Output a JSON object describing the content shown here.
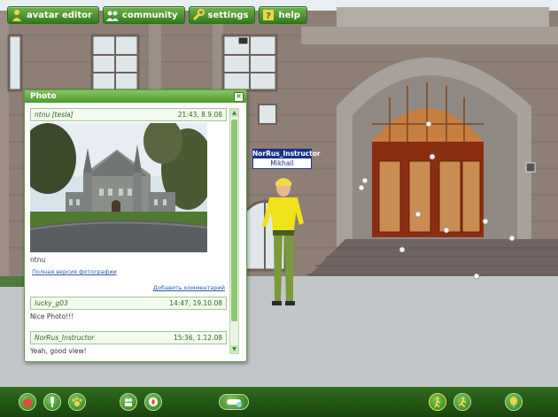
{
  "menu": {
    "avatar_editor": "avatar editor",
    "community": "community",
    "settings": "settings",
    "help": "help"
  },
  "nametag": {
    "name": "NorRus_Instructor",
    "subtitle": "Mikhail"
  },
  "photo_window": {
    "title": "Photo",
    "close_symbol": "×",
    "photo_post": {
      "author": "ntnu [tesla]",
      "timestamp": "21:43, 8.9.08",
      "caption": "ntnu",
      "full_version_link": "Полная версия фотографии",
      "add_comment_link": "Добавить комментарий"
    },
    "comments": [
      {
        "author": "lucky_g03",
        "timestamp": "14:47, 19.10.08",
        "text": "Nice Photo!!!"
      },
      {
        "author": "NorRus_Instructor",
        "timestamp": "15:36, 1.12.08",
        "text": "Yeah, good view!"
      }
    ]
  },
  "icons": {
    "top": [
      "avatar-icon",
      "community-icon",
      "wrench-icon",
      "help-icon"
    ],
    "bottom": [
      "apple-icon",
      "microphone-icon",
      "paw-icon",
      "people-icon",
      "compass-icon",
      "hand-icon",
      "walk-icon",
      "run-icon",
      "balloon-icon"
    ]
  },
  "colors": {
    "ui_green": "#4c9a2d",
    "link_blue": "#2b5aa5",
    "nametag_blue": "#1d2f8a"
  }
}
